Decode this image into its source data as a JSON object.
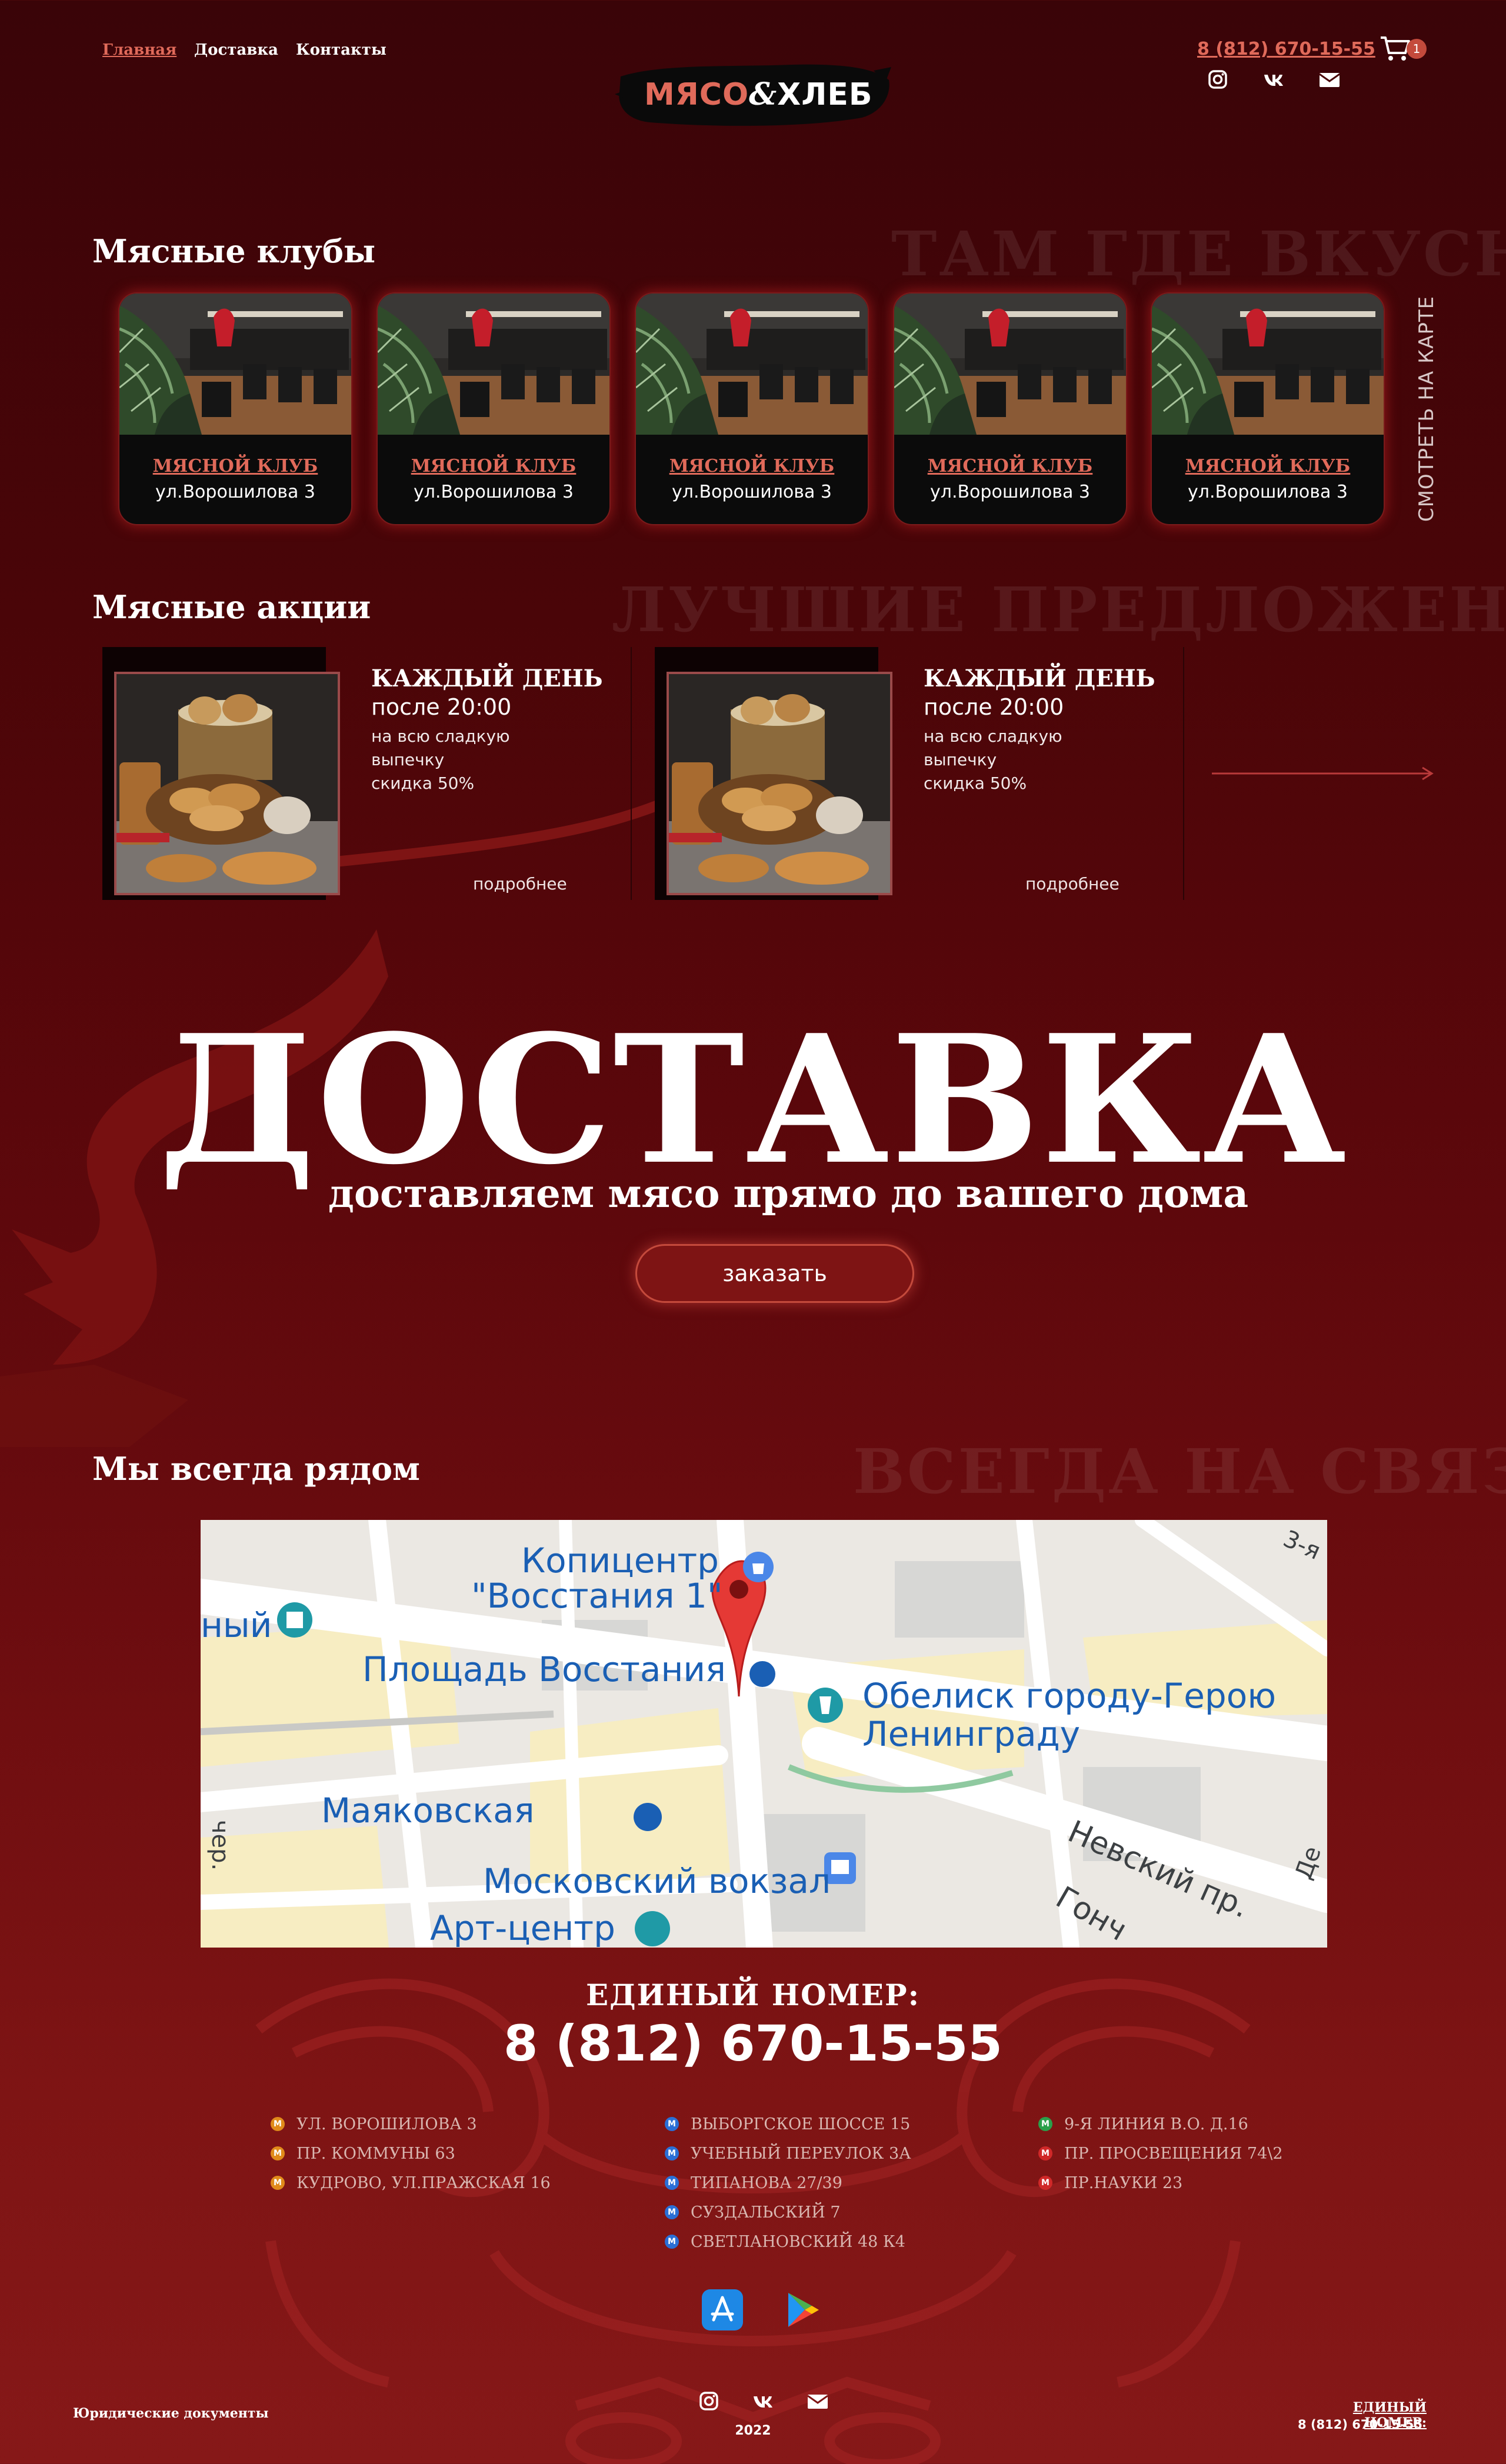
{
  "colors": {
    "accent": "#e06a5a",
    "bg_dark": "#3a0408",
    "bg_light": "#861818",
    "button": "#7e1414"
  },
  "nav": {
    "items": [
      "Главная",
      "Доставка",
      "Контакты"
    ],
    "active": "Главная"
  },
  "brand": {
    "logo_text_left": "МЯСО",
    "logo_amp": "&",
    "logo_text_right": "ХЛЕБ"
  },
  "header": {
    "phone": "8 (812) 670-15-55",
    "cart_count": "1",
    "socials": [
      "instagram-icon",
      "vk-icon",
      "mail-icon"
    ]
  },
  "clubs": {
    "title": "Мясные клубы",
    "bg_title": "ТАМ ГДЕ ВКУСНО",
    "map_link": "СМОТРЕТЬ НА КАРТЕ",
    "items": [
      {
        "name": "МЯСНОЙ КЛУБ",
        "address": "ул.Ворошилова  3"
      },
      {
        "name": "МЯСНОЙ КЛУБ",
        "address": "ул.Ворошилова  3"
      },
      {
        "name": "МЯСНОЙ КЛУБ",
        "address": "ул.Ворошилова  3"
      },
      {
        "name": "МЯСНОЙ КЛУБ",
        "address": "ул.Ворошилова  3"
      },
      {
        "name": "МЯСНОЙ КЛУБ",
        "address": "ул.Ворошилова  3"
      }
    ]
  },
  "promos": {
    "title": "Мясные акции",
    "bg_title": "ЛУЧШИЕ ПРЕДЛОЖЕНИЯ",
    "items": [
      {
        "title": "КАЖДЫЙ ДЕНЬ",
        "time": "после 20:00",
        "line1": "на всю сладкую",
        "line2": "выпечку",
        "line3": "скидка 50%",
        "more": "подробнее"
      },
      {
        "title": "КАЖДЫЙ ДЕНЬ",
        "time": "после 20:00",
        "line1": "на всю сладкую",
        "line2": "выпечку",
        "line3": "скидка 50%",
        "more": "подробнее"
      }
    ]
  },
  "delivery": {
    "title": "ДОСТАВКА",
    "subtitle": "доставляем  мясо прямо до вашего дома",
    "button": "заказать"
  },
  "map": {
    "title": "Мы всегда рядом",
    "bg_title": "ВСЕГДА НА СВЯЗИ",
    "labels": {
      "copy_center_1": "Копицентр",
      "copy_center_2": "\"Восстания 1\"",
      "square": "Площадь Восстания",
      "obelisk_1": "Обелиск городу-Герою",
      "obelisk_2": "Ленинграду",
      "mayak": "Маяковская",
      "moskovsky": "Московский вокзал",
      "art": "Арт-центр",
      "nevsky": "Невский пр.",
      "cut_left": "ный",
      "cut_top_right": "3-я",
      "cut_bottom_left": "чер.",
      "cut_bottom_mid": "Гонч",
      "cut_right": "Де"
    }
  },
  "contacts": {
    "unified_label": "ЕДИНЫЙ НОМЕР:",
    "phone": "8 (812) 670-15-55",
    "col1": [
      {
        "text": "УЛ. ВОРОШИЛОВА 3",
        "color": "#e08a1a"
      },
      {
        "text": "ПР. КОММУНЫ 63",
        "color": "#e08a1a"
      },
      {
        "text": "КУДРОВО, УЛ.ПРАЖСКАЯ 16",
        "color": "#e08a1a"
      }
    ],
    "col2": [
      {
        "text": "ВЫБОРГСКОЕ ШОССЕ 15",
        "color": "#2a6fd6"
      },
      {
        "text": "УЧЕБНЫЙ ПЕРЕУЛОК 3А",
        "color": "#2a6fd6"
      },
      {
        "text": "ТИПАНОВА 27/39",
        "color": "#2a6fd6"
      },
      {
        "text": "СУЗДАЛЬСКИЙ 7",
        "color": "#2a6fd6"
      },
      {
        "text": "СВЕТЛАНОВСКИЙ 48 К4",
        "color": "#2a6fd6"
      }
    ],
    "col3": [
      {
        "text": "9-Я ЛИНИЯ В.О. Д.16",
        "color": "#2aa04a"
      },
      {
        "text": "ПР. ПРОСВЕЩЕНИЯ 74\\2",
        "color": "#d02828"
      },
      {
        "text": "ПР.НАУКИ 23",
        "color": "#d02828"
      }
    ],
    "metro_glyph": "M",
    "apps": [
      "app-store-icon",
      "google-play-icon"
    ]
  },
  "footer": {
    "legal": "Юридические документы",
    "year": "2022",
    "unified_label": "ЕДИНЫЙ НОМЕР:",
    "phone": "8 (812) 670-15-55"
  }
}
